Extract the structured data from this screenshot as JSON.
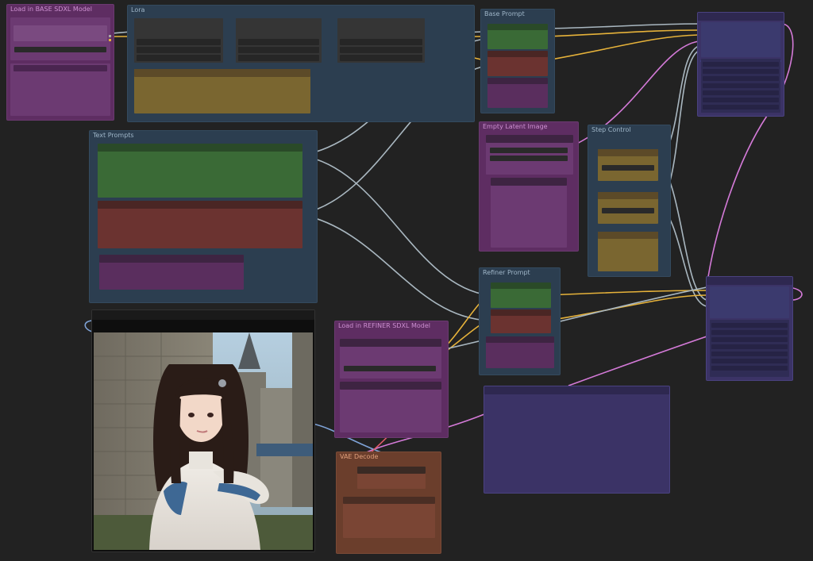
{
  "canvas": {
    "background": "#222222"
  },
  "groups": {
    "lora": {
      "title": "Lora",
      "color": "#2e3f52"
    },
    "text_prompts": {
      "title": "Text Prompts",
      "color": "#2e3f52"
    },
    "load_base": {
      "title": "Load in BASE SDXL Model",
      "color": "#6a2b6a"
    },
    "base_prompt": {
      "title": "Base Prompt",
      "color": "#2e3f52"
    },
    "empty_latent": {
      "title": "Empty Latent Image",
      "color": "#6a2b6a"
    },
    "step_control": {
      "title": "Step Control",
      "color": "#2e3f52"
    },
    "refiner_prompt": {
      "title": "Refiner Prompt",
      "color": "#2e3f52"
    },
    "load_refiner": {
      "title": "Load in REFINER SDXL Model",
      "color": "#6a2b6a"
    },
    "vae_decode": {
      "title": "VAE Decode",
      "color": "#6a3a24"
    }
  },
  "image_preview": {
    "description_icon": "portrait-image"
  },
  "colors": {
    "green_node": "#3a6a36",
    "red_node": "#6b3330",
    "purple_node": "#5a2e5e",
    "yellow_node": "#7a6630",
    "navy_node": "#3b3366",
    "brown_node": "#6b3e2c",
    "wire_yellow": "#e6b23a",
    "wire_pink": "#d47ad8",
    "wire_blue": "#7ea2d6",
    "wire_grey": "#a9b7c0",
    "wire_orange_red": "#e05a6a"
  }
}
